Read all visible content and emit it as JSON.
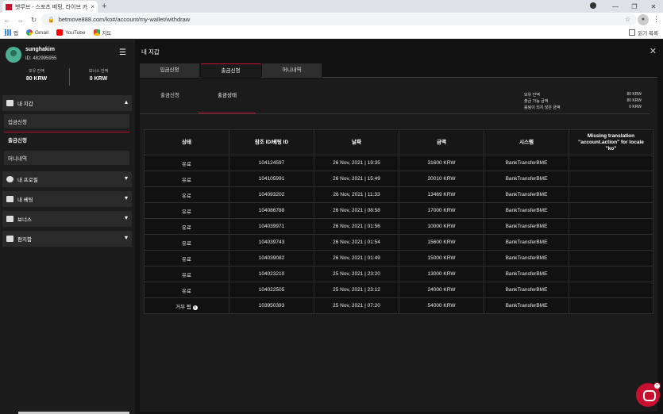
{
  "browser": {
    "tab_title": "벳무브 - 스포츠 베팅, 라이브 카지노",
    "tab_close": "×",
    "new_tab": "+",
    "url": "betmove888.com/ko#/account/my-wallet/withdraw",
    "bookmarks": [
      {
        "label": "앱",
        "icon": "apps-icon"
      },
      {
        "label": "Gmail",
        "icon": "google-icon"
      },
      {
        "label": "YouTube",
        "icon": "youtube-icon"
      },
      {
        "label": "지도",
        "icon": "maps-icon"
      }
    ],
    "reading_list": "읽기 목록"
  },
  "user": {
    "name": "sunghakim",
    "id": "ID: 482995955",
    "balance_label": "보유 잔액",
    "balance_value": "80 KRW",
    "bonus_label": "보너스 잔액",
    "bonus_value": "0 KRW"
  },
  "sidebar": {
    "wallet": "내 지갑",
    "deposit": "입금신청",
    "withdraw": "출금신청",
    "money_history": "머니내역",
    "profile": "내 프로필",
    "bets": "내 베팅",
    "bonus": "보너스",
    "messages": "편지함"
  },
  "main": {
    "title": "내 지갑",
    "close": "✕",
    "tabs": [
      "입금신청",
      "출금신청",
      "머니내역"
    ],
    "subtabs": [
      "출금신청",
      "출금상태"
    ]
  },
  "wallet_info": [
    {
      "label": "보유 잔액",
      "value": "80 KRW"
    },
    {
      "label": "출금 가능 금액",
      "value": "80 KRW"
    },
    {
      "label": "롤링이 되지 않은 금액",
      "value": "0 KRW"
    }
  ],
  "table": {
    "headers": [
      "상태",
      "참조 ID/베팅 ID",
      "날짜",
      "금액",
      "시스템",
      "Missing translation \"account.action\" for locale \"ko\""
    ],
    "rows": [
      [
        "유료",
        "104124597",
        "26 Nov, 2021 | 19:35",
        "31600 KRW",
        "BankTransferBME",
        ""
      ],
      [
        "유료",
        "104105991",
        "26 Nov, 2021 | 15:49",
        "20010 KRW",
        "BankTransferBME",
        ""
      ],
      [
        "유료",
        "104093202",
        "26 Nov, 2021 | 11:33",
        "13469 KRW",
        "BankTransferBME",
        ""
      ],
      [
        "유료",
        "104086788",
        "26 Nov, 2021 | 08:58",
        "17000 KRW",
        "BankTransferBME",
        ""
      ],
      [
        "유료",
        "104039971",
        "26 Nov, 2021 | 01:56",
        "10000 KRW",
        "BankTransferBME",
        ""
      ],
      [
        "유료",
        "104039743",
        "26 Nov, 2021 | 01:54",
        "15600 KRW",
        "BankTransferBME",
        ""
      ],
      [
        "유료",
        "104039082",
        "26 Nov, 2021 | 01:49",
        "15000 KRW",
        "BankTransferBME",
        ""
      ],
      [
        "유료",
        "104023210",
        "25 Nov, 2021 | 23:20",
        "13000 KRW",
        "BankTransferBME",
        ""
      ],
      [
        "유료",
        "104022505",
        "25 Nov, 2021 | 23:12",
        "24000 KRW",
        "BankTransferBME",
        ""
      ],
      [
        "거부 됨",
        "103950393",
        "25 Nov, 2021 | 07:20",
        "54000 KRW",
        "BankTransferBME",
        ""
      ]
    ],
    "rejected_info_icon": "i"
  },
  "chat_badge": "×",
  "colors": {
    "accent": "#c8102e",
    "background": "#111111",
    "panel": "#1b1b1b"
  }
}
